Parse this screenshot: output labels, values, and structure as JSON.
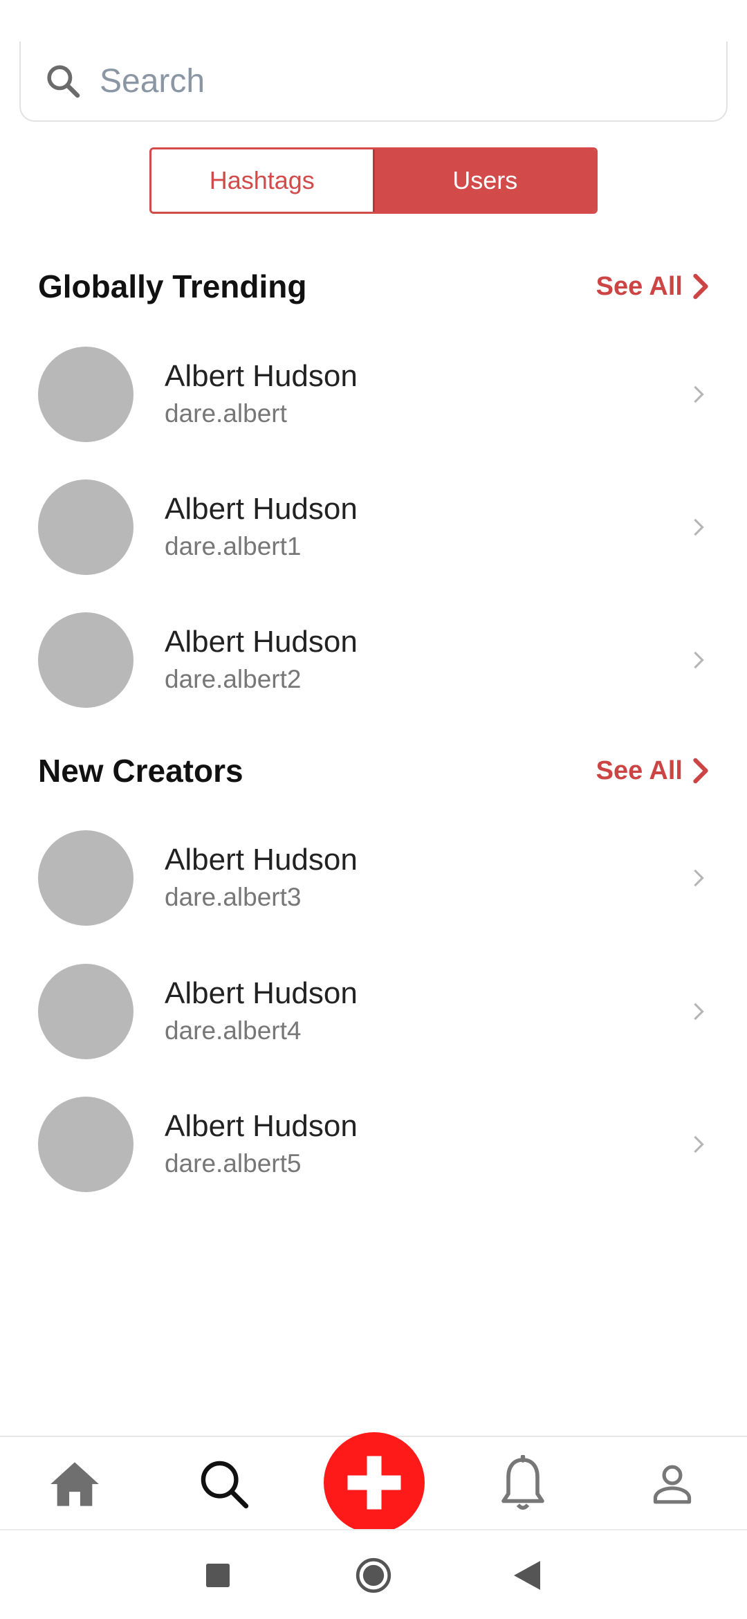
{
  "search": {
    "placeholder": "Search",
    "value": ""
  },
  "segments": [
    {
      "label": "Hashtags",
      "selected": false
    },
    {
      "label": "Users",
      "selected": true
    }
  ],
  "colors": {
    "accent": "#d34a4a",
    "fab": "#ff1a1a",
    "avatar": "#b8b8b8"
  },
  "sections": [
    {
      "title": "Globally Trending",
      "see_all": "See All",
      "users": [
        {
          "name": "Albert Hudson",
          "handle": "dare.albert"
        },
        {
          "name": "Albert Hudson",
          "handle": "dare.albert1"
        },
        {
          "name": "Albert Hudson",
          "handle": "dare.albert2"
        }
      ]
    },
    {
      "title": "New Creators",
      "see_all": "See All",
      "users": [
        {
          "name": "Albert Hudson",
          "handle": "dare.albert3"
        },
        {
          "name": "Albert Hudson",
          "handle": "dare.albert4"
        },
        {
          "name": "Albert Hudson",
          "handle": "dare.albert5"
        }
      ]
    }
  ],
  "bottom_nav": [
    "home-icon",
    "search-icon",
    "plus-icon",
    "bell-icon",
    "person-icon"
  ],
  "system_nav": [
    "square-icon",
    "circle-icon",
    "back-triangle-icon"
  ]
}
